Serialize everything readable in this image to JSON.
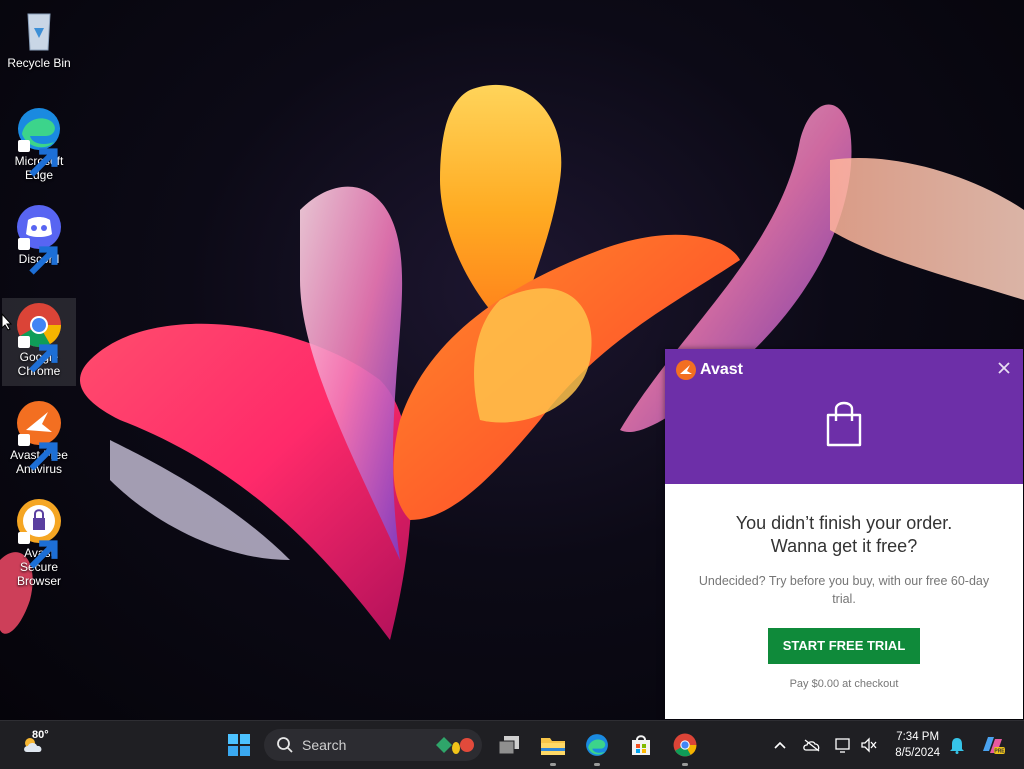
{
  "desktop": {
    "icons": [
      {
        "label_line1": "Recycle Bin",
        "label_line2": "",
        "icon": "recycle-bin-icon"
      },
      {
        "label_line1": "Microsoft",
        "label_line2": "Edge",
        "icon": "edge-icon"
      },
      {
        "label_line1": "Discord",
        "label_line2": "",
        "icon": "discord-icon"
      },
      {
        "label_line1": "Google",
        "label_line2": "Chrome",
        "icon": "chrome-icon"
      },
      {
        "label_line1": "Avast Free",
        "label_line2": "Antivirus",
        "icon": "avast-antivirus-icon"
      },
      {
        "label_line1": "Avast Secure",
        "label_line2": "Browser",
        "icon": "avast-browser-icon"
      }
    ]
  },
  "popup": {
    "brand": "Avast",
    "headline_line1": "You didn’t finish your order.",
    "headline_line2": "Wanna get it free?",
    "subtext": "Undecided? Try before you buy, with our free 60-day trial.",
    "cta_label": "START FREE TRIAL",
    "note": "Pay $0.00 at checkout",
    "colors": {
      "header": "#6d2fa8",
      "cta": "#0f8a3a",
      "brand_orange": "#f36f21"
    }
  },
  "taskbar": {
    "weather_temp": "80°",
    "search_label": "Search",
    "time": "7:34 PM",
    "date": "8/5/2024",
    "apps": [
      "start-icon",
      "task-view-icon",
      "file-explorer-icon",
      "edge-icon",
      "store-icon",
      "chrome-icon"
    ],
    "tray": [
      "chevron-up-icon",
      "onedrive-icon",
      "display-icon",
      "speaker-muted-icon",
      "notification-bell-icon",
      "copilot-icon"
    ]
  }
}
